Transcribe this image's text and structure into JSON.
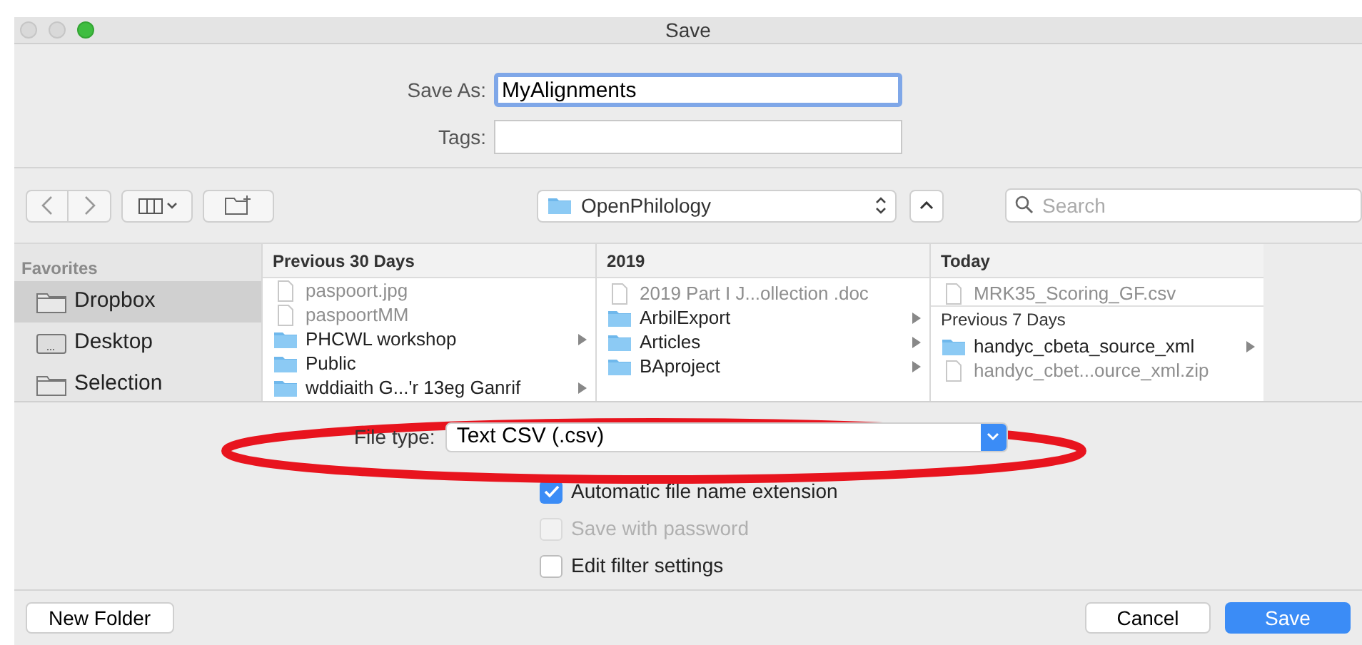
{
  "window": {
    "title": "Save"
  },
  "save_as": {
    "label": "Save As:",
    "value": "MyAlignments"
  },
  "tags": {
    "label": "Tags:"
  },
  "toolbar": {
    "location": "OpenPhilology",
    "search": {
      "placeholder": "Search"
    }
  },
  "sidebar": {
    "heading": "Favorites",
    "items": [
      {
        "label": "Dropbox",
        "kind": "folder",
        "selected": true
      },
      {
        "label": "Desktop",
        "kind": "desktop",
        "selected": false
      },
      {
        "label": "Selection",
        "kind": "folder",
        "selected": false
      }
    ]
  },
  "columns": [
    {
      "header": "Previous 30 Days",
      "items": [
        {
          "kind": "file",
          "name": "paspoort.jpg",
          "disabled": true,
          "has_children": false
        },
        {
          "kind": "file",
          "name": "paspoortMM",
          "disabled": true,
          "has_children": false
        },
        {
          "kind": "folder",
          "name": "PHCWL workshop",
          "disabled": false,
          "has_children": true
        },
        {
          "kind": "folder",
          "name": "Public",
          "disabled": false,
          "has_children": false
        },
        {
          "kind": "folder",
          "name": "wddiaith G...'r 13eg Ganrif",
          "disabled": false,
          "has_children": true
        }
      ]
    },
    {
      "header": "2019",
      "items": [
        {
          "kind": "file",
          "name": "2019 Part I J...ollection .doc",
          "disabled": true,
          "has_children": false
        },
        {
          "kind": "folder",
          "name": "ArbilExport",
          "disabled": false,
          "has_children": true
        },
        {
          "kind": "folder",
          "name": "Articles",
          "disabled": false,
          "has_children": true
        },
        {
          "kind": "folder",
          "name": "BAproject",
          "disabled": false,
          "has_children": true
        }
      ]
    },
    {
      "header": "Today",
      "items": [
        {
          "kind": "file",
          "name": "MRK35_Scoring_GF.csv",
          "disabled": true,
          "has_children": false
        },
        {
          "kind": "section",
          "name": "Previous 7 Days",
          "disabled": false,
          "has_children": false
        },
        {
          "kind": "folder",
          "name": "handyc_cbeta_source_xml",
          "disabled": false,
          "has_children": true
        },
        {
          "kind": "file",
          "name": "handyc_cbet...ource_xml.zip",
          "disabled": true,
          "has_children": false
        }
      ]
    }
  ],
  "file_type": {
    "label": "File type:",
    "value": "Text CSV (.csv)"
  },
  "options": [
    {
      "label": "Automatic file name extension",
      "checked": true,
      "disabled": false
    },
    {
      "label": "Save with password",
      "checked": false,
      "disabled": true
    },
    {
      "label": "Edit filter settings",
      "checked": false,
      "disabled": false
    }
  ],
  "buttons": {
    "new_folder": "New Folder",
    "cancel": "Cancel",
    "save": "Save"
  },
  "annotations": [
    {
      "kind": "ellipse"
    }
  ]
}
